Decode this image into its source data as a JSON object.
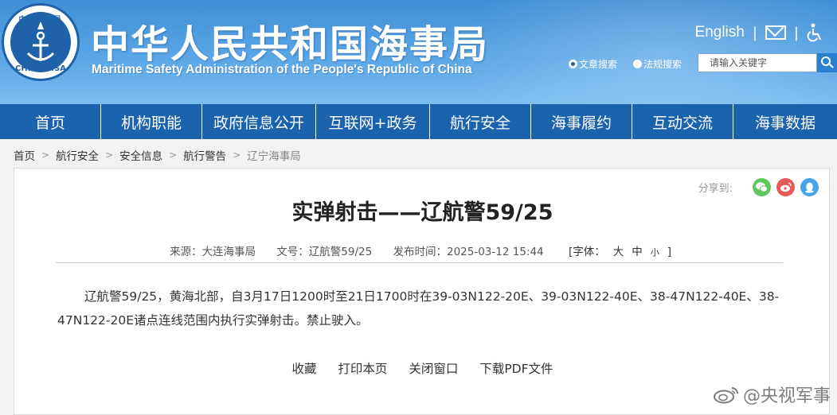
{
  "header": {
    "logo_text_top": "中国海事局",
    "logo_text_bottom": "CHINA MSA",
    "title_cn": "中华人民共和国海事局",
    "title_en": "Maritime Safety Administration of the People's Republic of China",
    "english_link": "English",
    "separator": "|",
    "icons": [
      "mail-icon",
      "accessibility-icon",
      "search-icon"
    ],
    "search": {
      "option_article": "文章搜索",
      "option_law": "法规搜索",
      "selected": "文章搜索",
      "placeholder": "请输入关键字"
    }
  },
  "nav": {
    "items": [
      {
        "label": "首页"
      },
      {
        "label": "机构职能"
      },
      {
        "label": "政府信息公开"
      },
      {
        "label": "互联网+政务"
      },
      {
        "label": "航行安全"
      },
      {
        "label": "海事履约"
      },
      {
        "label": "互动交流"
      },
      {
        "label": "海事数据"
      }
    ]
  },
  "breadcrumb": {
    "items": [
      "首页",
      "航行安全",
      "安全信息",
      "航行警告",
      "辽宁海事局"
    ],
    "separator": ">"
  },
  "article": {
    "share_label": "分享到:",
    "share_icons": [
      "wechat-icon",
      "weibo-icon",
      "qq-icon"
    ],
    "title": "实弹射击——辽航警59/25",
    "meta": {
      "source": "来源：大连海事局",
      "doc_no": "文号：辽航警59/25",
      "published": "发布时间：2025-03-12 15:44",
      "font_label": "[字体：",
      "font_large": "大",
      "font_medium": "中",
      "font_small": "小",
      "font_close": "]"
    },
    "body": "辽航警59/25，黄海北部，自3月17日1200时至21日1700时在39-03N122-20E、39-03N122-40E、38-47N122-40E、38-47N122-20E诸点连线范围内执行实弹射击。禁止驶入。",
    "actions": {
      "favorite": "收藏",
      "print": "打印本页",
      "close": "关闭窗口",
      "download": "下载PDF文件"
    }
  },
  "watermark": {
    "text": "@央视军事"
  },
  "colors": {
    "nav_bg": "#1c63ae",
    "header_bg": "#4a9ade",
    "wechat": "#5fc85d",
    "weibo": "#e65a58",
    "qq": "#45a5e8"
  }
}
